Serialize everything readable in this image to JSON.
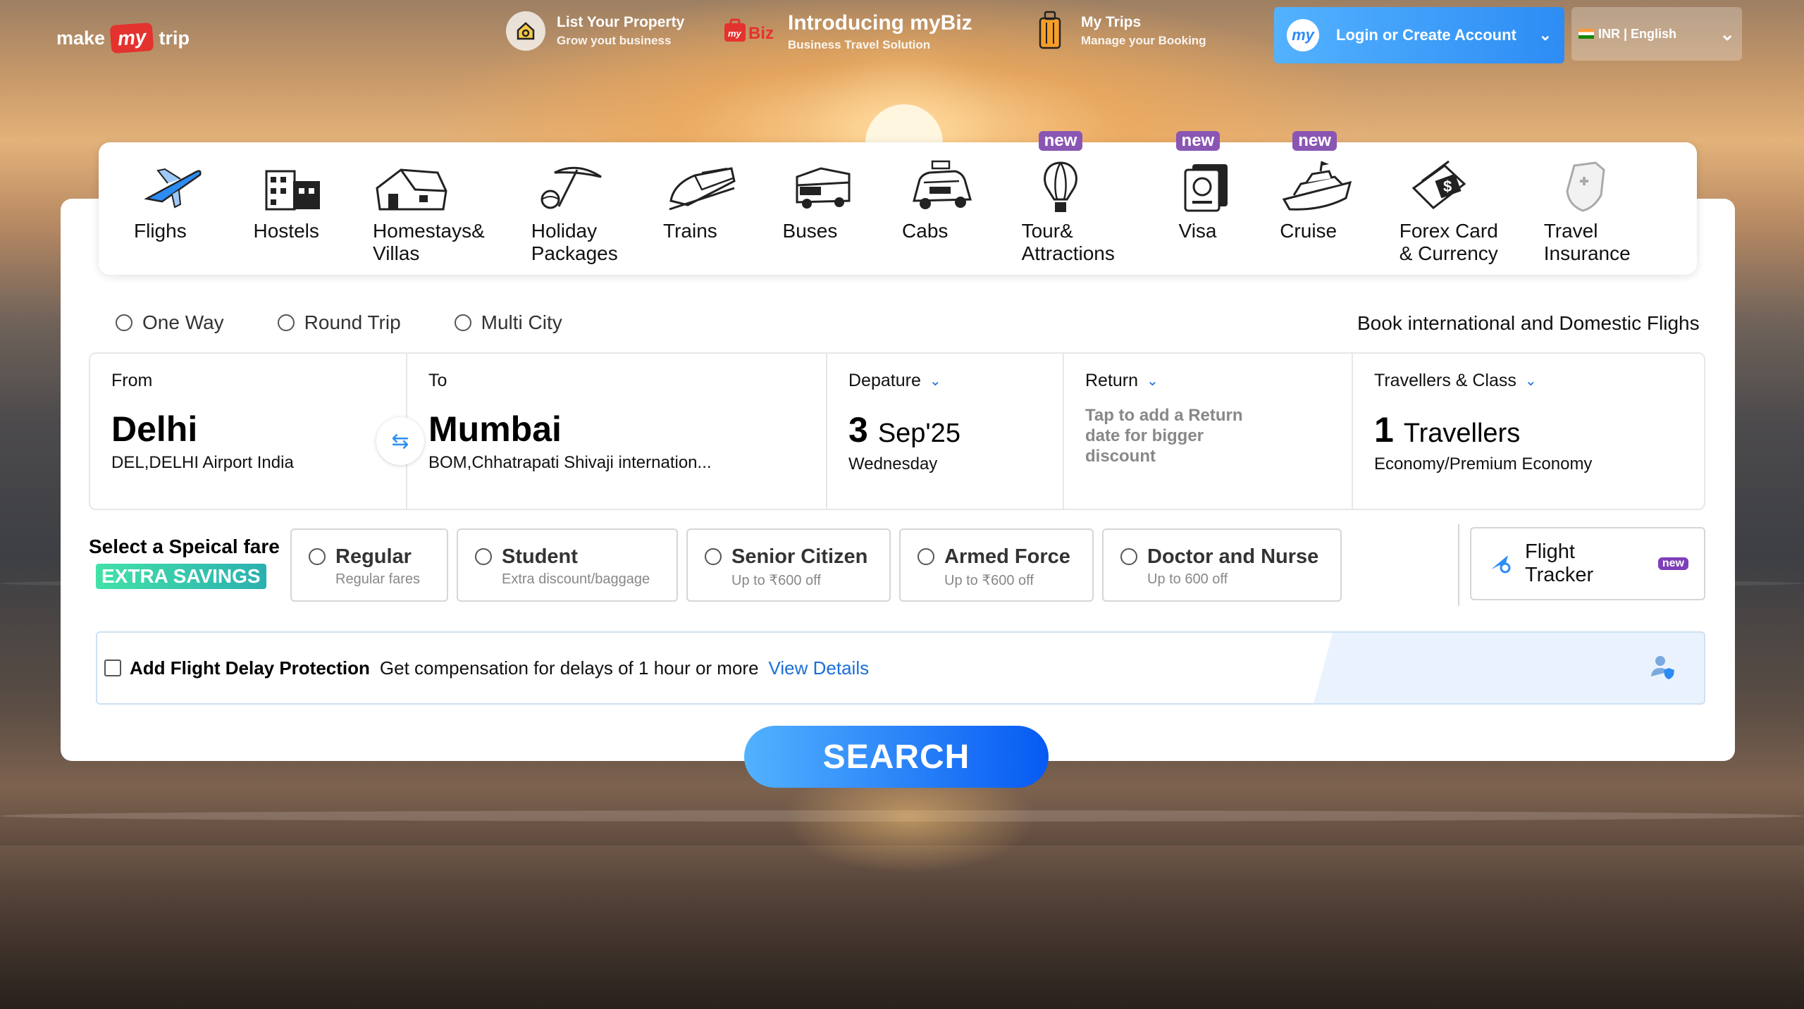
{
  "header": {
    "logo": {
      "make": "make",
      "my": "my",
      "trip": "trip"
    },
    "list_property": {
      "title": "List Your Property",
      "subtitle": "Grow yout business"
    },
    "mybiz": {
      "title": "Introducing myBiz",
      "subtitle": "Business Travel Solution",
      "brand": "my Biz"
    },
    "my_trips": {
      "title": "My Trips",
      "subtitle": "Manage your Booking"
    },
    "login": {
      "label": "Login or Create Account",
      "avatar": "my"
    },
    "currency_language": "INR | English"
  },
  "nav": [
    {
      "id": "flights",
      "label": "Flighs",
      "icon": "plane-icon",
      "badge": ""
    },
    {
      "id": "hostels",
      "label": "Hostels",
      "icon": "hostel-icon",
      "badge": ""
    },
    {
      "id": "homestays",
      "label": "Homestays& Villas",
      "icon": "house-icon",
      "badge": ""
    },
    {
      "id": "holiday",
      "label": "Holiday Packages",
      "icon": "beach-umbrella-icon",
      "badge": ""
    },
    {
      "id": "trains",
      "label": "Trains",
      "icon": "train-icon",
      "badge": ""
    },
    {
      "id": "buses",
      "label": "Buses",
      "icon": "bus-icon",
      "badge": ""
    },
    {
      "id": "cabs",
      "label": "Cabs",
      "icon": "cab-icon",
      "badge": ""
    },
    {
      "id": "tours",
      "label": "Tour& Attractions",
      "icon": "hot-air-balloon-icon",
      "badge": "new"
    },
    {
      "id": "visa",
      "label": "Visa",
      "icon": "passport-icon",
      "badge": "new"
    },
    {
      "id": "cruise",
      "label": "Cruise",
      "icon": "cruise-ship-icon",
      "badge": "new"
    },
    {
      "id": "forex",
      "label": "Forex Card & Currency",
      "icon": "forex-card-icon",
      "badge": ""
    },
    {
      "id": "insurance",
      "label": "Travel Insurance",
      "icon": "insurance-shield-icon",
      "badge": ""
    }
  ],
  "trip_types": [
    "One Way",
    "Round Trip",
    "Multi City"
  ],
  "book_label": "Book international and Domestic Flighs",
  "search": {
    "from": {
      "label": "From",
      "city": "Delhi",
      "airport": "DEL,DELHI Airport India"
    },
    "to": {
      "label": "To",
      "city": "Mumbai",
      "airport": "BOM,Chhatrapati Shivaji internation..."
    },
    "departure": {
      "label": "Depature",
      "day": "3",
      "month_year": "Sep'25",
      "weekday": "Wednesday"
    },
    "return": {
      "label": "Return",
      "hint": "Tap to add a Return date for bigger discount"
    },
    "travellers": {
      "label": "Travellers & Class",
      "count": "1",
      "unit": "Travellers",
      "class": "Economy/Premium Economy"
    }
  },
  "fares": {
    "title": "Select a Speical fare",
    "badge": "EXTRA SAVINGS",
    "options": [
      {
        "title": "Regular",
        "subtitle": "Regular fares"
      },
      {
        "title": "Student",
        "subtitle": "Extra discount/baggage"
      },
      {
        "title": "Senior Citizen",
        "subtitle": "Up to ₹600 off"
      },
      {
        "title": "Armed Force",
        "subtitle": "Up to ₹600 off"
      },
      {
        "title": "Doctor and Nurse",
        "subtitle": "Up to 600 off"
      }
    ]
  },
  "tracker": {
    "label": "Flight Tracker",
    "badge": "new"
  },
  "delay": {
    "title": "Add Flight Delay Protection",
    "text": "Get compensation for delays of 1 hour or more",
    "link": "View Details"
  },
  "search_button": "SEARCH",
  "colors": {
    "brand_red": "#e4322f",
    "accent_blue": "#2d8cf4",
    "new_badge": "#8a56b3",
    "savings_green": "#43e1a8"
  }
}
